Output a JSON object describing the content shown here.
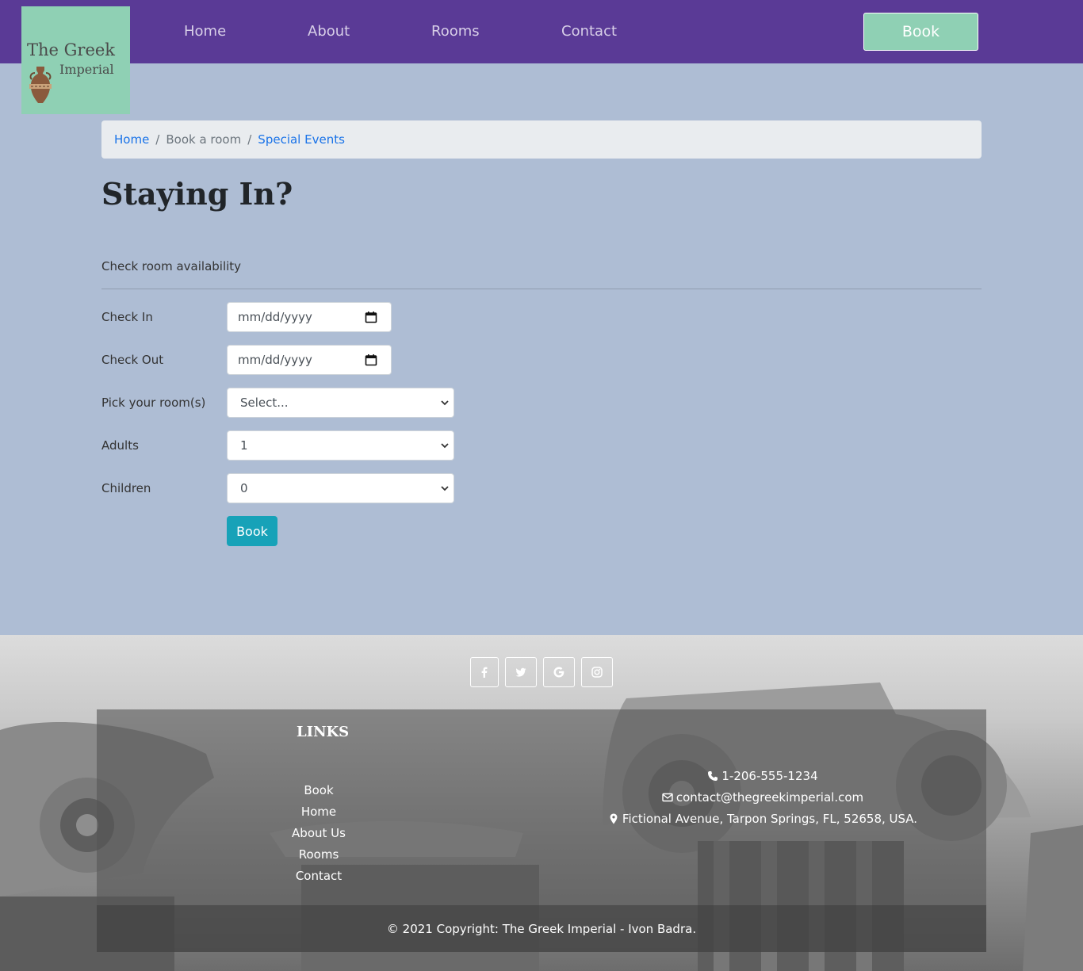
{
  "brand": {
    "logo_line1": "The Greek",
    "logo_line2": "Imperial"
  },
  "nav": {
    "items": [
      {
        "label": "Home"
      },
      {
        "label": "About"
      },
      {
        "label": "Rooms"
      },
      {
        "label": "Contact"
      }
    ],
    "book_label": "Book"
  },
  "breadcrumb": {
    "items": [
      {
        "label": "Home"
      },
      {
        "label": "Book a room"
      },
      {
        "label": "Special Events"
      }
    ],
    "separator": "/"
  },
  "page": {
    "title": "Staying In?",
    "subtitle": "Check room availability"
  },
  "form": {
    "check_in": {
      "label": "Check In",
      "value": "mm/dd/yyyy"
    },
    "check_out": {
      "label": "Check Out",
      "value": "mm/dd/yyyy"
    },
    "rooms": {
      "label": "Pick your room(s)",
      "value": "Select..."
    },
    "adults": {
      "label": "Adults",
      "value": "1"
    },
    "children": {
      "label": "Children",
      "value": "0"
    },
    "submit_label": "Book"
  },
  "footer": {
    "social": [
      {
        "icon": "facebook-icon"
      },
      {
        "icon": "twitter-icon"
      },
      {
        "icon": "google-icon"
      },
      {
        "icon": "instagram-icon"
      }
    ],
    "links_title": "LINKS",
    "links": [
      {
        "label": "Book"
      },
      {
        "label": "Home"
      },
      {
        "label": "About Us"
      },
      {
        "label": "Rooms"
      },
      {
        "label": "Contact"
      }
    ],
    "contact": {
      "phone": "1-206-555-1234",
      "email": "contact@thegreekimperial.com",
      "address": "Fictional Avenue, Tarpon Springs, FL, 52658, USA."
    },
    "copyright": "© 2021 Copyright: The Greek Imperial - Ivon Badra."
  },
  "colors": {
    "nav_bg": "#5a3a96",
    "accent_mint": "#8fd0b4",
    "page_bg": "#aebdd4",
    "submit_teal": "#17a2b8",
    "link_blue": "#1a73e8"
  }
}
